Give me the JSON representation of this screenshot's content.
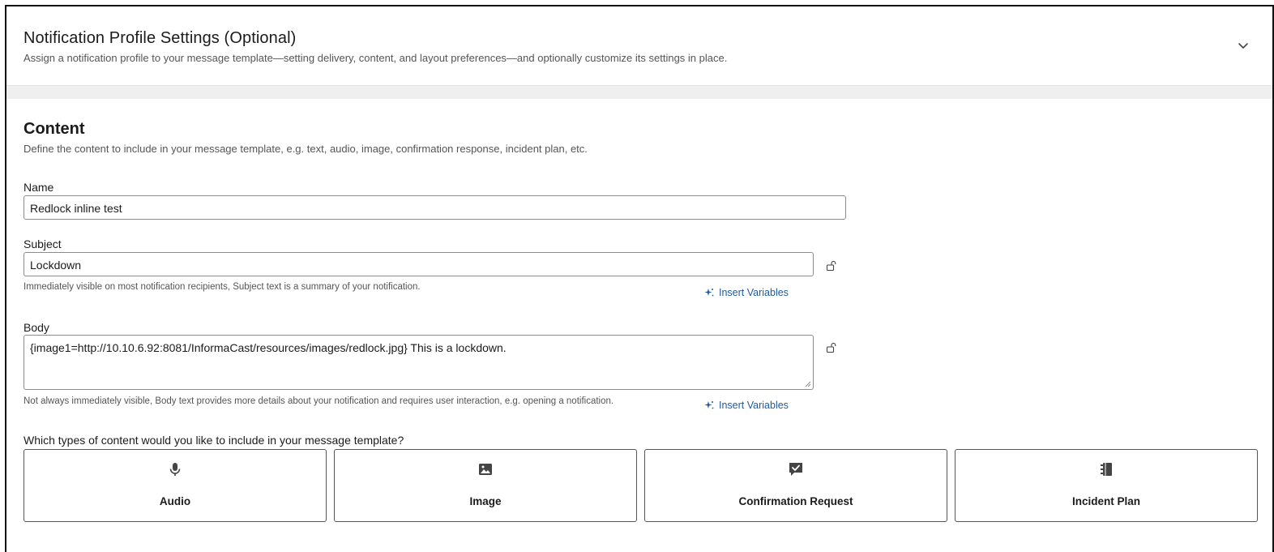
{
  "profile": {
    "title": "Notification Profile Settings (Optional)",
    "subtitle": "Assign a notification profile to your message template—setting delivery, content, and layout preferences—and optionally customize its settings in place."
  },
  "content": {
    "title": "Content",
    "subtitle": "Define the content to include in your message template, e.g. text, audio, image, confirmation response, incident plan, etc."
  },
  "name_field": {
    "label": "Name",
    "value": "Redlock inline test"
  },
  "subject_field": {
    "label": "Subject",
    "value": "Lockdown",
    "helper": "Immediately visible on most notification recipients, Subject text is a summary of your notification.",
    "insert_label": "Insert Variables"
  },
  "body_field": {
    "label": "Body",
    "value": "{image1=http://10.10.6.92:8081/InformaCast/resources/images/redlock.jpg} This is a lockdown.",
    "helper": "Not always immediately visible, Body text provides more details about your notification and requires user interaction, e.g. opening a notification.",
    "insert_label": "Insert Variables"
  },
  "content_types": {
    "question": "Which types of content would you like to include in your message template?",
    "tiles": [
      {
        "label": "Audio",
        "icon": "microphone-icon"
      },
      {
        "label": "Image",
        "icon": "image-icon"
      },
      {
        "label": "Confirmation Request",
        "icon": "confirmation-icon"
      },
      {
        "label": "Incident Plan",
        "icon": "incident-plan-icon"
      }
    ]
  },
  "colors": {
    "link": "#1e5a9c",
    "border": "#8c8c8c",
    "icon": "#444444"
  }
}
